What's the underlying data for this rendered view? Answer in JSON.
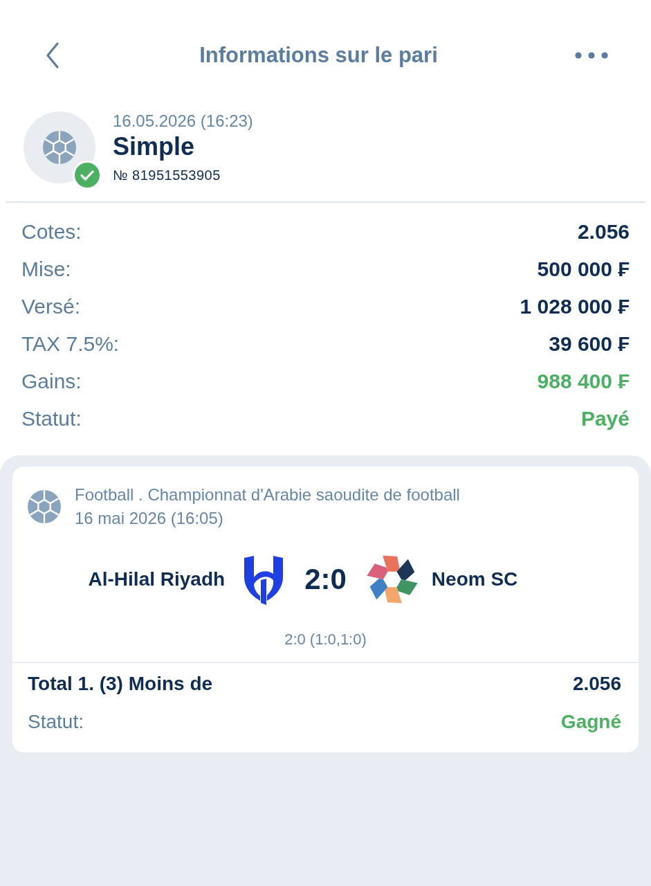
{
  "header": {
    "title": "Informations sur le pari"
  },
  "bet": {
    "date": "16.05.2026 (16:23)",
    "type": "Simple",
    "number": "№ 81951553905",
    "won": true
  },
  "summary": [
    {
      "label": "Cotes:",
      "value": "2.056",
      "kind": "plain"
    },
    {
      "label": "Mise:",
      "value": "500 000 ₣",
      "kind": "plain"
    },
    {
      "label": "Versé:",
      "value": "1 028 000 ₣",
      "kind": "plain"
    },
    {
      "label": "TAX 7.5%:",
      "value": "39 600 ₣",
      "kind": "plain"
    },
    {
      "label": "Gains:",
      "value": "988 400 ₣",
      "kind": "positive"
    },
    {
      "label": "Statut:",
      "value": "Payé",
      "kind": "positive"
    }
  ],
  "event": {
    "league": "Football . Championnat d'Arabie saoudite de football",
    "date": "16 mai 2026 (16:05)",
    "home_team": "Al-Hilal Riyadh",
    "score": "2:0",
    "away_team": "Neom SC",
    "score_detail": "2:0 (1:0,1:0)",
    "selection": "Total 1. (3) Moins de",
    "odds": "2.056",
    "status": {
      "label": "Statut:",
      "value": "Gagné",
      "kind": "positive"
    }
  }
}
